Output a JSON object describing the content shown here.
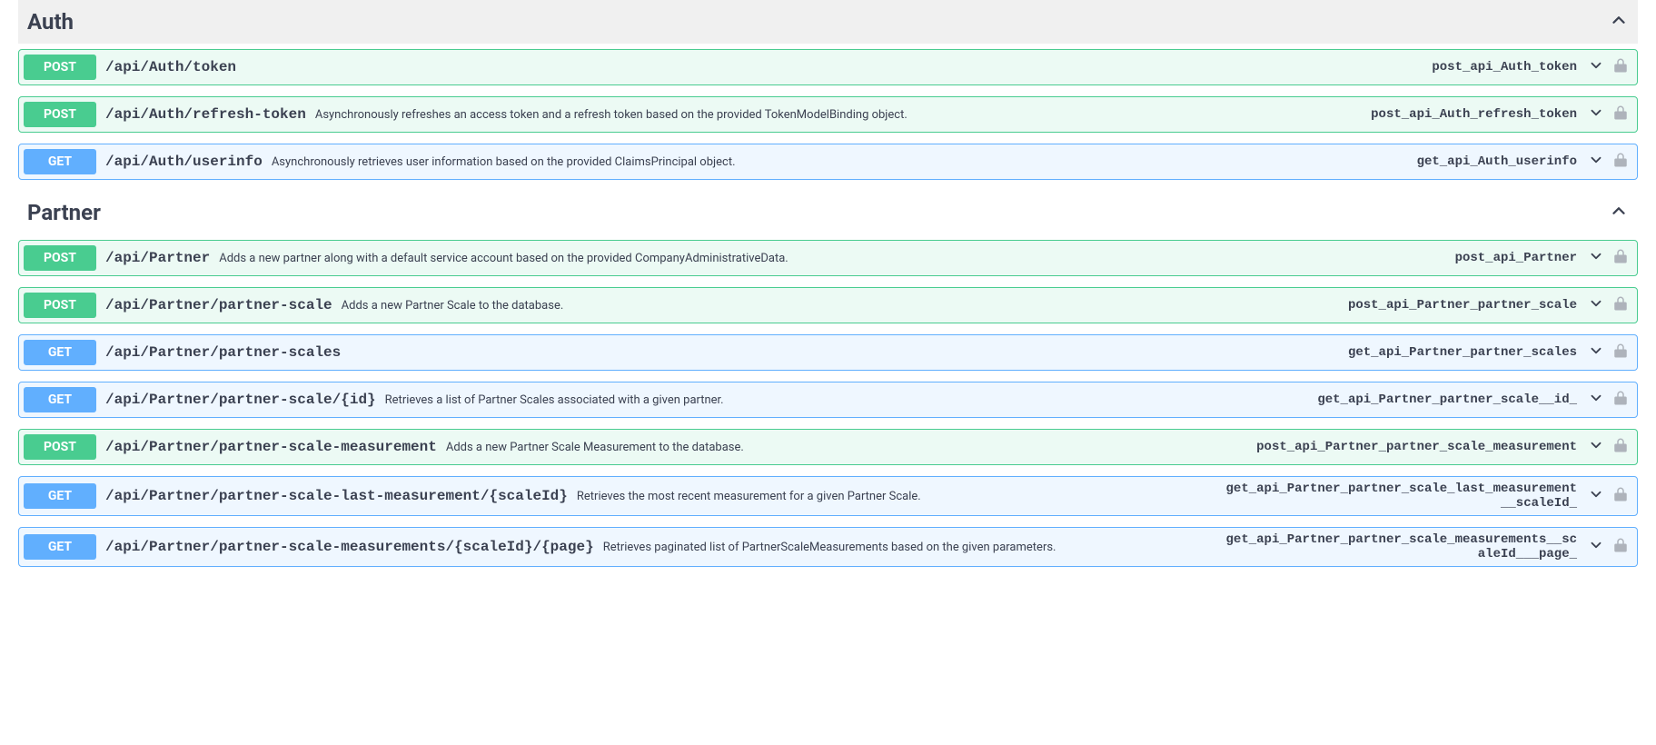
{
  "sections": [
    {
      "name": "Auth",
      "first": true,
      "operations": [
        {
          "method": "POST",
          "path": "/api/Auth/token",
          "summary": "",
          "operationId": "post_api_Auth_token"
        },
        {
          "method": "POST",
          "path": "/api/Auth/refresh-token",
          "summary": "Asynchronously refreshes an access token and a refresh token based on the provided TokenModelBinding object.",
          "operationId": "post_api_Auth_refresh_token"
        },
        {
          "method": "GET",
          "path": "/api/Auth/userinfo",
          "summary": "Asynchronously retrieves user information based on the provided ClaimsPrincipal object.",
          "operationId": "get_api_Auth_userinfo"
        }
      ]
    },
    {
      "name": "Partner",
      "first": false,
      "operations": [
        {
          "method": "POST",
          "path": "/api/Partner",
          "summary": "Adds a new partner along with a default service account based on the provided CompanyAdministrativeData.",
          "operationId": "post_api_Partner"
        },
        {
          "method": "POST",
          "path": "/api/Partner/partner-scale",
          "summary": "Adds a new Partner Scale to the database.",
          "operationId": "post_api_Partner_partner_scale"
        },
        {
          "method": "GET",
          "path": "/api/Partner/partner-scales",
          "summary": "",
          "operationId": "get_api_Partner_partner_scales"
        },
        {
          "method": "GET",
          "path": "/api/Partner/partner-scale/{id}",
          "summary": "Retrieves a list of Partner Scales associated with a given partner.",
          "operationId": "get_api_Partner_partner_scale__id_"
        },
        {
          "method": "POST",
          "path": "/api/Partner/partner-scale-measurement",
          "summary": "Adds a new Partner Scale Measurement to the database.",
          "operationId": "post_api_Partner_partner_scale_measurement"
        },
        {
          "method": "GET",
          "path": "/api/Partner/partner-scale-last-measurement/{scaleId}",
          "summary": "Retrieves the most recent measurement for a given Partner Scale.",
          "operationId": "get_api_Partner_partner_scale_last_measurement__scaleId_"
        },
        {
          "method": "GET",
          "path": "/api/Partner/partner-scale-measurements/{scaleId}/{page}",
          "summary": "Retrieves paginated list of PartnerScaleMeasurements based on the given parameters.",
          "operationId": "get_api_Partner_partner_scale_measurements__scaleId___page_"
        }
      ]
    }
  ]
}
